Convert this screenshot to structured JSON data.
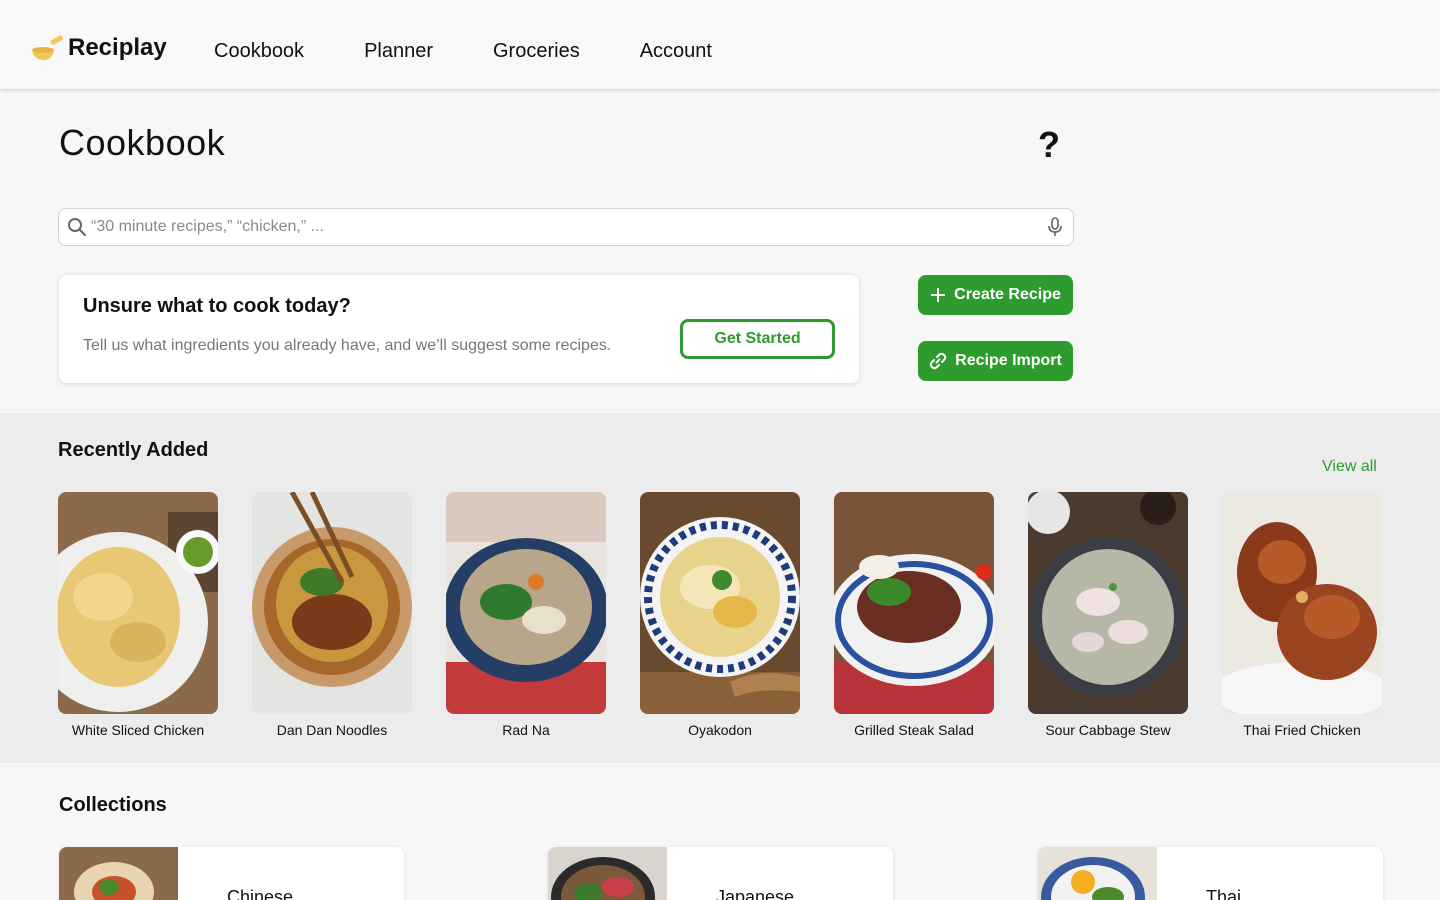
{
  "app": {
    "brand_name": "Reciplay",
    "brand_icon": "pan-icon",
    "accent_color": "#2e9b2e"
  },
  "nav": {
    "items": [
      {
        "label": "Cookbook"
      },
      {
        "label": "Planner"
      },
      {
        "label": "Groceries"
      },
      {
        "label": "Account"
      }
    ]
  },
  "page": {
    "title": "Cookbook",
    "help_label": "?"
  },
  "search": {
    "placeholder": "“30 minute recipes,” “chicken,” ...",
    "value": ""
  },
  "suggest": {
    "title": "Unsure what to cook today?",
    "text": "Tell us what ingredients you already have, and we’ll suggest some recipes.",
    "button_label": "Get Started"
  },
  "actions": {
    "create_label": "Create Recipe",
    "import_label": "Recipe Import"
  },
  "recent": {
    "title": "Recently Added",
    "view_all_label": "View all",
    "items": [
      {
        "name": "White Sliced Chicken"
      },
      {
        "name": "Dan Dan Noodles"
      },
      {
        "name": "Rad Na"
      },
      {
        "name": "Oyakodon"
      },
      {
        "name": "Grilled Steak Salad"
      },
      {
        "name": "Sour Cabbage Stew"
      },
      {
        "name": "Thai Fried Chicken"
      }
    ]
  },
  "collections": {
    "title": "Collections",
    "items": [
      {
        "name": "Chinese"
      },
      {
        "name": "Japanese"
      },
      {
        "name": "Thai"
      }
    ]
  }
}
